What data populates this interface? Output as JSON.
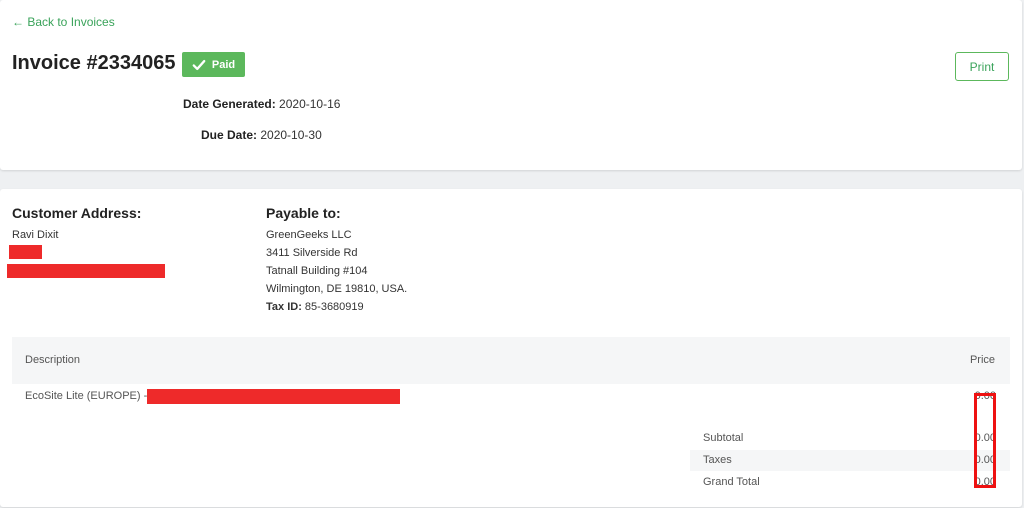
{
  "header": {
    "back_link": "← Back to Invoices",
    "invoice_title": "Invoice #2334065",
    "status_badge": "Paid",
    "print_label": "Print",
    "date_generated_label": "Date Generated:",
    "date_generated_value": "2020-10-16",
    "due_date_label": "Due Date:",
    "due_date_value": "2020-10-30"
  },
  "customer": {
    "heading": "Customer Address:",
    "name": "Ravi Dixit"
  },
  "payable": {
    "heading": "Payable to:",
    "lines": [
      "GreenGeeks LLC",
      "3411 Silverside Rd",
      "Tatnall Building #104",
      "Wilmington, DE 19810, USA."
    ],
    "tax_label": "Tax ID:",
    "tax_value": "85-3680919"
  },
  "items_table": {
    "columns": [
      "Description",
      "Price"
    ],
    "rows": [
      {
        "description": "EcoSite Lite (EUROPE) -",
        "price": "0.00"
      }
    ]
  },
  "totals": [
    {
      "label": "Subtotal",
      "value": "0.00"
    },
    {
      "label": "Taxes",
      "value": "0.00"
    },
    {
      "label": "Grand Total",
      "value": "0.00"
    }
  ],
  "colors": {
    "accent_green": "#5cb85c",
    "link_green": "#3aa35a",
    "redaction_red": "#ee2a2a"
  }
}
